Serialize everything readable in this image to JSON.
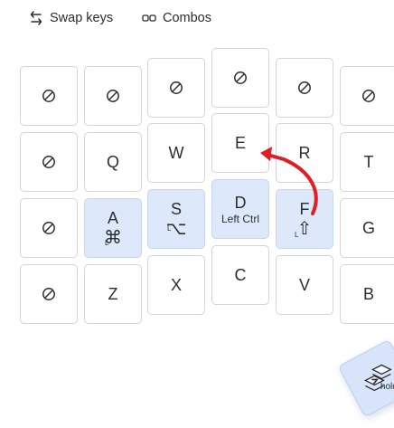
{
  "toolbar": {
    "swap_keys_label": "Swap keys",
    "combos_label": "Combos",
    "swap_icon": "swap-arrows-icon",
    "combos_icon": "combos-icon"
  },
  "keys": {
    "r0c0": {
      "icon": "none-icon"
    },
    "r0c1": {
      "icon": "none-icon"
    },
    "r0c2": {
      "icon": "none-icon"
    },
    "r0c3": {
      "icon": "none-icon"
    },
    "r0c4": {
      "icon": "none-icon"
    },
    "r0c5": {
      "icon": "none-icon"
    },
    "r1c0": {
      "icon": "none-icon"
    },
    "r1c1": {
      "label": "Q"
    },
    "r1c2": {
      "label": "W"
    },
    "r1c3": {
      "label": "E"
    },
    "r1c4": {
      "label": "R"
    },
    "r1c5": {
      "label": "T"
    },
    "r2c0": {
      "icon": "none-icon"
    },
    "r2c1": {
      "label": "A",
      "modifier": "⌘",
      "side": "L"
    },
    "r2c2": {
      "label": "S",
      "modifier": "⌥",
      "side": "L"
    },
    "r2c3": {
      "label": "D",
      "sublabel": "Left Ctrl"
    },
    "r2c4": {
      "label": "F",
      "modifier": "⇧",
      "side": "L"
    },
    "r2c5": {
      "label": "G"
    },
    "r3c0": {
      "icon": "none-icon"
    },
    "r3c1": {
      "label": "Z"
    },
    "r3c2": {
      "label": "X"
    },
    "r3c3": {
      "label": "C"
    },
    "r3c4": {
      "label": "V"
    },
    "r3c5": {
      "label": "B"
    }
  },
  "drag_key": {
    "hold_label": "hold",
    "icon": "layer-stack-icon"
  },
  "colors": {
    "modifier_key_bg": "#dde8fb",
    "swap_arrow": "#e01e27"
  }
}
